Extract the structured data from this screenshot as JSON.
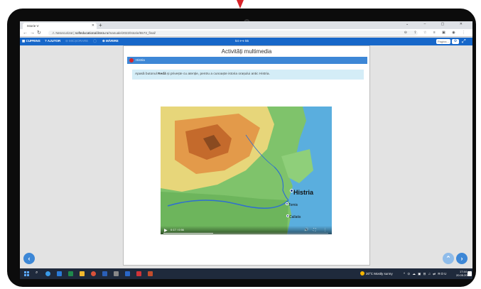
{
  "browser": {
    "tab_title": "Istorie V",
    "url_security": "Nesecurizat",
    "url_domain": "softeducational.litera.ro",
    "url_path": "/manuale/2022/Istorie/5573_final/"
  },
  "site_header": {
    "cuprins": "CUPRINS",
    "ajutor": "AJUTOR",
    "micsorare": "MICȘORARE",
    "marire": "MĂRIRE",
    "page_range": "54 ⟷ 55",
    "page_placeholder": "Pagina..."
  },
  "card": {
    "title": "Activități multimedia",
    "section_label": "Histria",
    "instruction_pre": "Apasă butonul ",
    "instruction_bold": "Redă",
    "instruction_post": " și privește cu atenție, pentru a cunoaște istoria orașului antic Histria."
  },
  "video": {
    "time": "0:17 / 0:56",
    "progress": 0.3,
    "labels": {
      "histria": "Histria",
      "tomis": "Tomis",
      "callatis": "Callatis"
    }
  },
  "taskbar": {
    "weather": "20°C  Mostly sunny",
    "lang": "ROU",
    "time": "17:44",
    "date": "20.05.2022"
  },
  "colors": {
    "accent": "#1767c9",
    "section": "#3d87d6",
    "instruction_bg": "#d4edf7",
    "marker": "#d8232a"
  },
  "icons": [
    "grid-icon",
    "question-icon",
    "zoom-out-icon",
    "reset-icon",
    "zoom-in-icon",
    "gear-icon",
    "fullscreen-icon",
    "play-icon",
    "volume-icon",
    "more-icon",
    "arrow-left-icon",
    "arrow-up-icon",
    "arrow-right-icon"
  ]
}
